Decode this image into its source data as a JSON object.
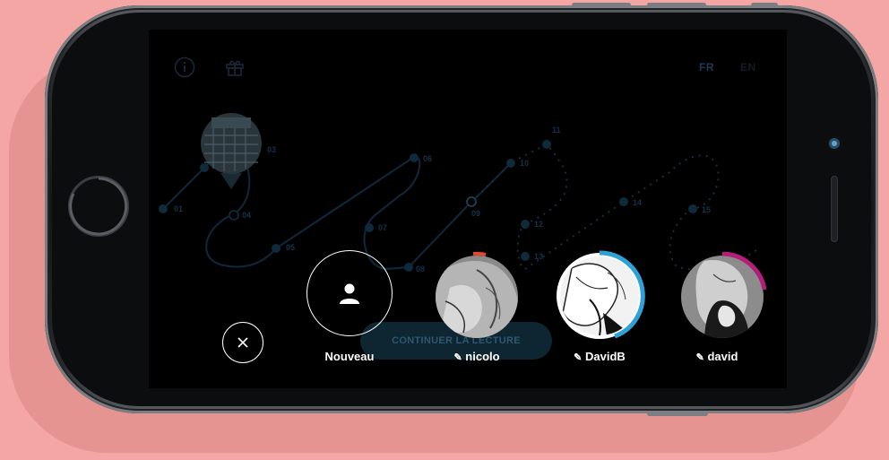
{
  "header": {
    "info_icon": "info-icon",
    "gift_icon": "gift-icon",
    "languages": [
      {
        "label": "FR",
        "active": true
      },
      {
        "label": "EN",
        "active": false
      }
    ]
  },
  "chapters": [
    "01",
    "03",
    "04",
    "05",
    "06",
    "07",
    "08",
    "09",
    "10",
    "11",
    "12",
    "13",
    "14",
    "15"
  ],
  "continue_button": {
    "label": "CONTINUER LA LECTURE"
  },
  "profiles": [
    {
      "name": "Nouveau",
      "type": "new",
      "icon": "user-icon"
    },
    {
      "name": "nicolo",
      "type": "user",
      "edit_icon": "pencil-icon",
      "progress": 0.05,
      "progress_color": "#e8452f"
    },
    {
      "name": "DavidB",
      "type": "user",
      "edit_icon": "pencil-icon",
      "progress": 0.45,
      "progress_color": "#2ea1d6"
    },
    {
      "name": "david",
      "type": "user",
      "edit_icon": "pencil-icon",
      "progress": 0.2,
      "progress_color": "#b41d7a"
    }
  ],
  "close_button": {
    "icon": "close-icon"
  },
  "colors": {
    "background": "#f3a6a4",
    "screen": "#000000",
    "path_dim": "#0f2636",
    "accent_blue": "#2ea1d6",
    "accent_red": "#e8452f",
    "accent_magenta": "#b41d7a"
  }
}
